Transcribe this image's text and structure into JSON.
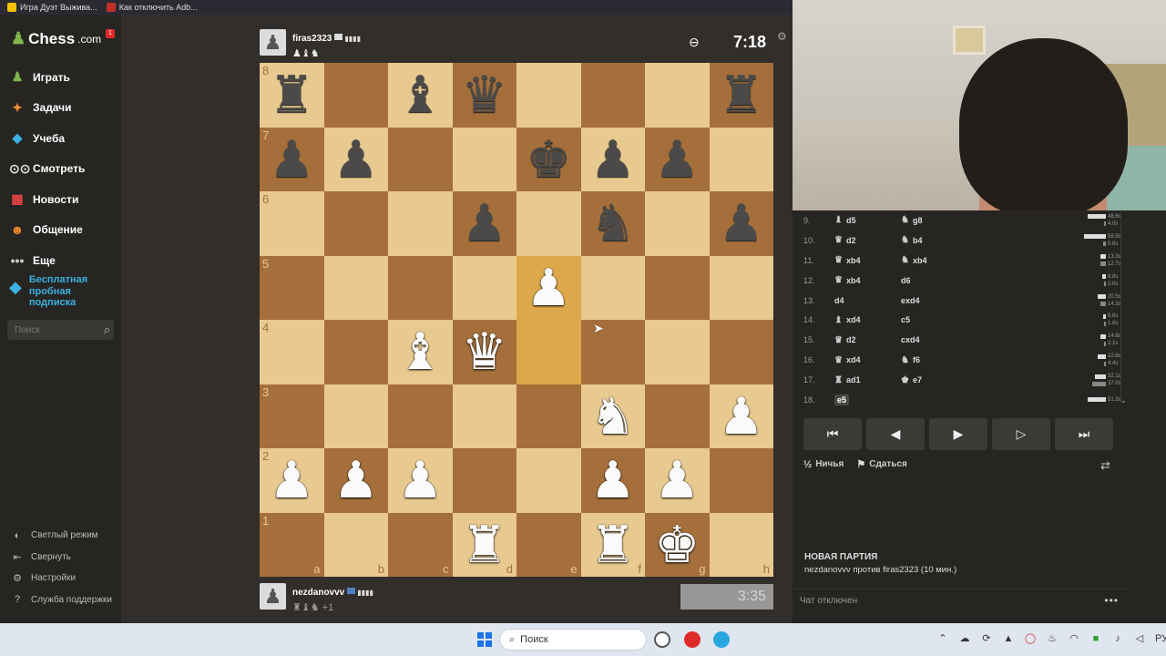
{
  "browser_tabs": [
    {
      "label": "Игра Дуэт Выжива...",
      "color": "#f5c400"
    },
    {
      "label": "Как отключить Adb...",
      "color": "#c03028"
    }
  ],
  "sidebar": {
    "logo_text": "Chess",
    "logo_suffix": ".com",
    "badge": "1",
    "nav": [
      {
        "label": "Играть",
        "icon": "play-icon",
        "glyph": "♟",
        "color": "#81b64c"
      },
      {
        "label": "Задачи",
        "icon": "puzzle-icon",
        "glyph": "✦",
        "color": "#f0892e"
      },
      {
        "label": "Учеба",
        "icon": "lessons-icon",
        "glyph": "◆",
        "color": "#3ab1e0"
      },
      {
        "label": "Смотреть",
        "icon": "watch-icon",
        "glyph": "⊙⊙",
        "color": "#dddddd"
      },
      {
        "label": "Новости",
        "icon": "news-icon",
        "glyph": "▦",
        "color": "#e84444"
      },
      {
        "label": "Общение",
        "icon": "social-icon",
        "glyph": "☻",
        "color": "#f0892e"
      },
      {
        "label": "Еще",
        "icon": "more-icon",
        "glyph": "•••",
        "color": "#cccccc"
      }
    ],
    "promo": "Бесплатная пробная подписка",
    "search_placeholder": "Поиск",
    "bottom": [
      {
        "label": "Светлый режим",
        "glyph": "◐"
      },
      {
        "label": "Свернуть",
        "glyph": "⇤"
      },
      {
        "label": "Настройки",
        "glyph": "⚙"
      },
      {
        "label": "Служба поддержки",
        "glyph": "?"
      }
    ]
  },
  "top_player": {
    "name": "firas2323",
    "captured": "♟♝♞",
    "clock": "7:18"
  },
  "bottom_player": {
    "name": "nezdanovvv",
    "captured": "♜♝♞ +1",
    "clock": "3:35"
  },
  "board": {
    "highlight_squares": [
      "e5",
      "e4"
    ],
    "rows": [
      [
        "br",
        "",
        "bb",
        "bq",
        "",
        "",
        "",
        "br"
      ],
      [
        "bp",
        "bp",
        "",
        "",
        "bk",
        "bp",
        "bp",
        ""
      ],
      [
        "",
        "",
        "",
        "bp",
        "",
        "bn",
        "",
        "bp"
      ],
      [
        "",
        "",
        "",
        "",
        "wp",
        "",
        "",
        ""
      ],
      [
        "",
        "",
        "wb",
        "wq",
        "",
        "",
        "",
        ""
      ],
      [
        "",
        "",
        "",
        "",
        "",
        "wn",
        "",
        "wp"
      ],
      [
        "wp",
        "wp",
        "wp",
        "",
        "",
        "wp",
        "wp",
        ""
      ],
      [
        "",
        "",
        "",
        "wr",
        "",
        "wr",
        "wk",
        ""
      ]
    ],
    "ranks": [
      "8",
      "7",
      "6",
      "5",
      "4",
      "3",
      "2",
      "1"
    ],
    "files": [
      "a",
      "b",
      "c",
      "d",
      "e",
      "f",
      "g",
      "h"
    ]
  },
  "moves": [
    {
      "n": "9.",
      "w_piece": "♝",
      "w": "d5",
      "b_piece": "♞",
      "b": "g8",
      "tw": "48.6s",
      "tb": "4.0s",
      "fw": 0.18,
      "fb": 0.02
    },
    {
      "n": "10.",
      "w_piece": "♛",
      "w": "d2",
      "b_piece": "♞",
      "b": "b4",
      "tw": "59.5s",
      "tb": "5.8s",
      "fw": 0.21,
      "fb": 0.03
    },
    {
      "n": "11.",
      "w_piece": "♛",
      "w": "xb4",
      "b_piece": "♞",
      "b": "xb4",
      "tw": "13.3s",
      "tb": "12.7s",
      "fw": 0.05,
      "fb": 0.05
    },
    {
      "n": "12.",
      "w_piece": "♛",
      "w": "xb4",
      "b_piece": "",
      "b": "d6",
      "tw": "9.8s",
      "tb": "3.0s",
      "fw": 0.04,
      "fb": 0.02
    },
    {
      "n": "13.",
      "w_piece": "",
      "w": "d4",
      "b_piece": "",
      "b": "exd4",
      "tw": "20.5s",
      "tb": "14.3s",
      "fw": 0.08,
      "fb": 0.05
    },
    {
      "n": "14.",
      "w_piece": "♝",
      "w": "xd4",
      "b_piece": "",
      "b": "c5",
      "tw": "8.8s",
      "tb": "1.6s",
      "fw": 0.03,
      "fb": 0.01
    },
    {
      "n": "15.",
      "w_piece": "♛",
      "w": "d2",
      "b_piece": "",
      "b": "cxd4",
      "tw": "14.6s",
      "tb": "2.1s",
      "fw": 0.05,
      "fb": 0.01
    },
    {
      "n": "16.",
      "w_piece": "♛",
      "w": "xd4",
      "b_piece": "♞",
      "b": "f6",
      "tw": "22.8s",
      "tb": "4.4s",
      "fw": 0.08,
      "fb": 0.02
    },
    {
      "n": "17.",
      "w_piece": "♜",
      "w": "ad1",
      "b_piece": "♚",
      "b": "e7",
      "tw": "32.1s",
      "tb": "37.0s",
      "fw": 0.11,
      "fb": 0.13
    },
    {
      "n": "18.",
      "w_piece": "",
      "w": "e5",
      "b_piece": "",
      "b": "",
      "tw": "51.3s",
      "tb": "",
      "fw": 0.18,
      "fb": 0,
      "current": true
    }
  ],
  "controls": [
    "⏮",
    "◀",
    "▶",
    "▷",
    "⏭"
  ],
  "actions": {
    "draw": "Ничья",
    "draw_icon": "½",
    "resign": "Сдаться",
    "resign_icon": "⚑"
  },
  "game": {
    "title": "НОВАЯ ПАРТИЯ",
    "desc": "nezdanovvv против firas2323 (10 мин.)"
  },
  "chat": {
    "status": "Чат отключен"
  },
  "taskbar": {
    "search_label": "Поиск",
    "lang": "РУС"
  }
}
